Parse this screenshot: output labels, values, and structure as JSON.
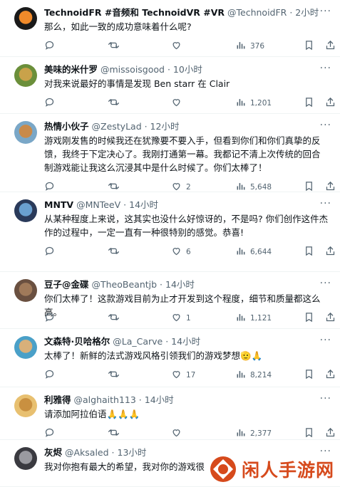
{
  "tweets": [
    {
      "name": "TechnoidFR #音频和 TechnoidVR #VR",
      "handle": "@TechnoidFR",
      "time": "· 2小时",
      "text": "那么，如此一致的成功意味着什么呢?",
      "replies": "",
      "retweets": "",
      "likes": "",
      "views": "376"
    },
    {
      "name": "美味的米什罗",
      "handle": "@missoisgood",
      "time": "· 10小时",
      "text": "对我来说最好的事情是发现 Ben starr 在 Clair",
      "replies": "",
      "retweets": "",
      "likes": "",
      "views": "1,201"
    },
    {
      "name": "热情小伙子",
      "handle": "@ZestyLad",
      "time": "· 12小时",
      "text": "游戏刚发售的时候我还在犹豫要不要入手，但看到你们和你们真挚的反馈，我终于下定决心了。我刚打通第一幕。我都记不清上次传统的回合制游戏能让我这么沉浸其中是什么时候了。你们太棒了！",
      "replies": "",
      "retweets": "",
      "likes": "2",
      "views": "5,648"
    },
    {
      "name": "MNTV",
      "handle": "@MNTeeV",
      "time": "· 14小时",
      "text": "从某种程度上来说，这其实也没什么好惊讶的，不是吗? 你们创作这件杰作的过程中，一定一直有一种很特别的感觉。恭喜!",
      "replies": "",
      "retweets": "",
      "likes": "6",
      "views": "6,644"
    },
    {
      "name": "豆子@金碟",
      "handle": "@TheoBeantjb",
      "time": "· 14小时",
      "text": "你们太棒了！这款游戏目前为止才开发到这个程度，细节和质量都这么高。",
      "replies": "",
      "retweets": "",
      "likes": "1",
      "views": "1,121"
    },
    {
      "name": "文森特·贝哈格尔",
      "handle": "@La_Carve",
      "time": "· 14小时",
      "text": "太棒了！新鲜的法式游戏风格引领我们的游戏梦想🫡🙏",
      "replies": "",
      "retweets": "",
      "likes": "17",
      "views": "8,214"
    },
    {
      "name": "利雅得",
      "handle": "@alghaith113",
      "time": "· 14小时",
      "text": "请添加阿拉伯语🙏🙏🙏",
      "replies": "",
      "retweets": "",
      "likes": "",
      "views": "2,377"
    },
    {
      "name": "灰烬",
      "handle": "@Aksaled",
      "time": "· 13小时",
      "text": "我对你抱有最大的希望，我对你的游戏很",
      "replies": "",
      "retweets": "",
      "likes": "",
      "views": ""
    }
  ],
  "more_glyph": "···",
  "watermark": {
    "text": "闲人手游网"
  }
}
